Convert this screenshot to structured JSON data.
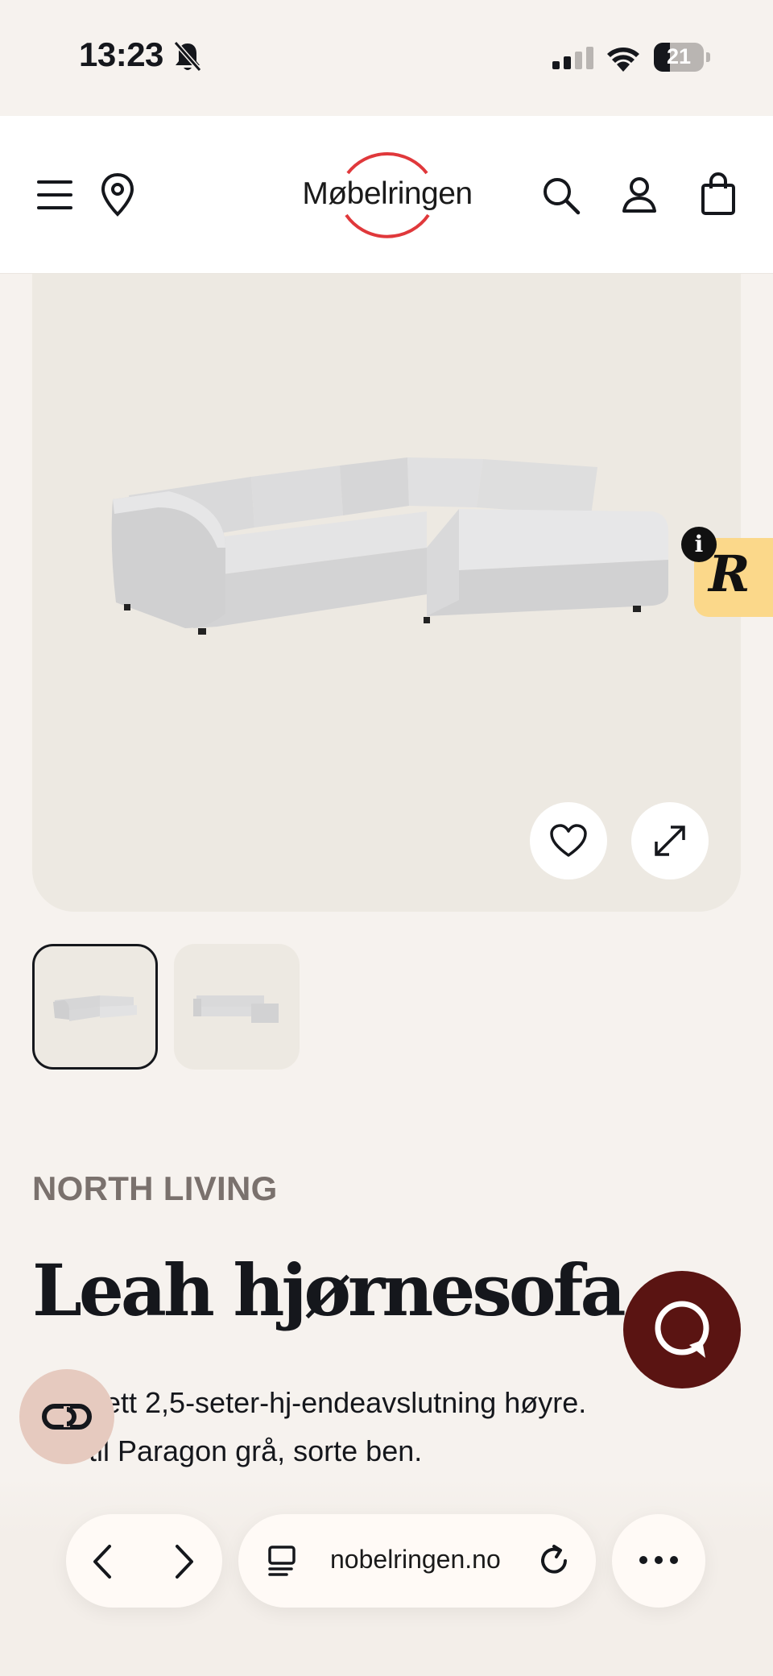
{
  "status_bar": {
    "time": "13:23",
    "battery": "21",
    "icons": [
      "bell-slash-icon",
      "cellular-signal-icon",
      "wifi-icon",
      "battery-icon"
    ]
  },
  "header": {
    "logo_text": "Møbelringen",
    "icons": [
      "menu-icon",
      "location-pin-icon",
      "search-icon",
      "account-icon",
      "bag-icon"
    ],
    "brand_color": "#e0383b"
  },
  "gallery": {
    "actions": [
      "heart-icon",
      "expand-icon"
    ],
    "thumbnail_count": 2,
    "selected_thumbnail": 1,
    "badge_letter": "R",
    "badge_info": "i"
  },
  "product": {
    "brand": "NORTH LIVING",
    "title": "Leah hjørnesofa",
    "desc_line1": "ett 2,5-seter-hj-endeavslutning høyre.",
    "desc_line2": "til Paragon grå, sorte ben."
  },
  "browser": {
    "url": "nobelringen.no",
    "icons": [
      "back-arrow-icon",
      "forward-arrow-icon",
      "tabs-icon",
      "reload-icon",
      "more-icon"
    ]
  },
  "colors": {
    "background": "#f6f2ee",
    "hero": "#ede9e2",
    "chat_button": "#5a1412",
    "badge": "#fbd88a",
    "loop_button": "#e6cabf"
  }
}
